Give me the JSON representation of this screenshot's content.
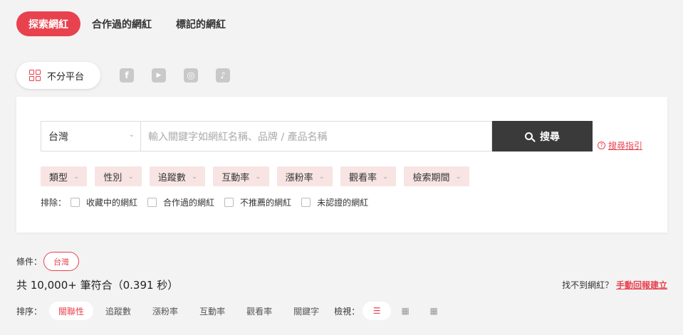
{
  "tabs": [
    "探索網紅",
    "合作過的網紅",
    "標記的網紅"
  ],
  "platforms": {
    "all_label": "不分平台",
    "icons": [
      "facebook-icon",
      "youtube-icon",
      "instagram-icon",
      "tiktok-icon"
    ],
    "glyphs": [
      "f",
      "▶",
      "◎",
      "♪"
    ]
  },
  "search": {
    "region": "台灣",
    "placeholder": "輸入關鍵字如網紅名稱、品牌 / 產品名稱",
    "button": "搜尋",
    "guide": "搜尋指引"
  },
  "filters": [
    "類型",
    "性別",
    "追蹤數",
    "互動率",
    "漲粉率",
    "觀看率",
    "檢索期間"
  ],
  "exclude": {
    "label": "排除：",
    "options": [
      "收藏中的網紅",
      "合作過的網紅",
      "不推薦的網紅",
      "未認證的網紅"
    ]
  },
  "conditions": {
    "label": "條件：",
    "tags": [
      "台灣"
    ]
  },
  "results": {
    "summary": "共 10,000+ 筆符合（0.391 秒）"
  },
  "report": {
    "text": "找不到網紅？",
    "link": "手動回報建立"
  },
  "sort": {
    "label": "排序：",
    "options": [
      "關聯性",
      "追蹤數",
      "漲粉率",
      "互動率",
      "觀看率",
      "關鍵字"
    ],
    "active": "關聯性"
  },
  "view": {
    "label": "檢視：",
    "modes": [
      "list",
      "card",
      "table"
    ],
    "active": "list"
  },
  "colors": {
    "accent": "#e8424f",
    "filter_bg": "#f7e4e3",
    "button_dark": "#3a3a3a"
  }
}
